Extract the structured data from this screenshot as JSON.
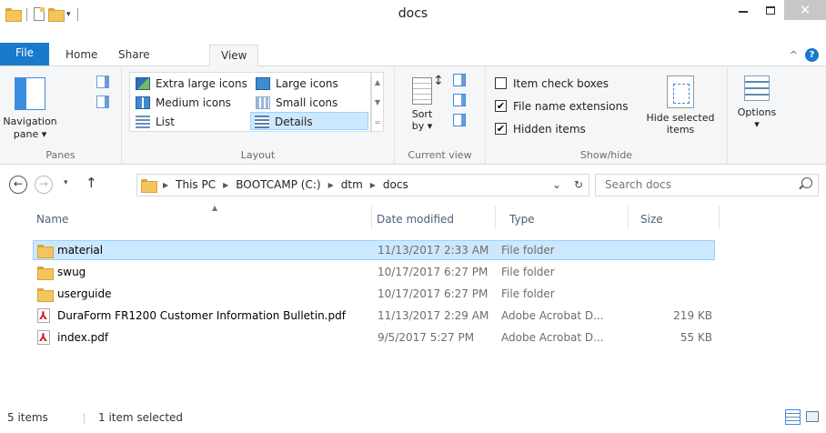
{
  "window": {
    "title": "docs",
    "minimize": "–",
    "close": "✕"
  },
  "tabs": [
    {
      "label": "File"
    },
    {
      "label": "Home"
    },
    {
      "label": "Share"
    },
    {
      "label": "View"
    }
  ],
  "ribbon": {
    "panes": {
      "navigation_pane": "Navigation",
      "navigation_pane_2": "pane ▾",
      "group_label": "Panes"
    },
    "layout": {
      "items": [
        {
          "label": "Extra large icons"
        },
        {
          "label": "Large icons"
        },
        {
          "label": "Medium icons"
        },
        {
          "label": "Small icons"
        },
        {
          "label": "List"
        },
        {
          "label": "Details"
        }
      ],
      "group_label": "Layout",
      "selected": "Details"
    },
    "current_view": {
      "sort_by": "Sort",
      "sort_by_2": "by ▾",
      "group_label": "Current view"
    },
    "show_hide": {
      "item_check_boxes": "Item check boxes",
      "file_name_extensions": "File name extensions",
      "hidden_items": "Hidden items",
      "item_check_boxes_checked": false,
      "file_name_extensions_checked": true,
      "hidden_items_checked": true,
      "hide_selected": "Hide selected",
      "hide_selected_2": "items",
      "group_label": "Show/hide"
    },
    "options": {
      "label": "Options",
      "dropdown": "▾"
    }
  },
  "address": {
    "crumbs": [
      "This PC",
      "BOOTCAMP (C:)",
      "dtm",
      "docs"
    ],
    "search_placeholder": "Search docs"
  },
  "columns": {
    "name": "Name",
    "date_modified": "Date modified",
    "type": "Type",
    "size": "Size"
  },
  "files": [
    {
      "name": "material",
      "date": "11/13/2017 2:33 AM",
      "type": "File folder",
      "size": "",
      "icon": "folder-icon",
      "selected": true
    },
    {
      "name": "swug",
      "date": "10/17/2017 6:27 PM",
      "type": "File folder",
      "size": "",
      "icon": "folder-icon",
      "selected": false
    },
    {
      "name": "userguide",
      "date": "10/17/2017 6:27 PM",
      "type": "File folder",
      "size": "",
      "icon": "folder-icon",
      "selected": false
    },
    {
      "name": "DuraForm FR1200 Customer Information Bulletin.pdf",
      "date": "11/13/2017 2:29 AM",
      "type": "Adobe Acrobat D...",
      "size": "219 KB",
      "icon": "pdf-icon",
      "selected": false
    },
    {
      "name": "index.pdf",
      "date": "9/5/2017 5:27 PM",
      "type": "Adobe Acrobat D...",
      "size": "55 KB",
      "icon": "pdf-icon",
      "selected": false
    }
  ],
  "status": {
    "item_count": "5 items",
    "selection": "1 item selected"
  },
  "colors": {
    "accent": "#1979ca",
    "selection": "#cce8ff",
    "selection_border": "#99d1ff"
  }
}
